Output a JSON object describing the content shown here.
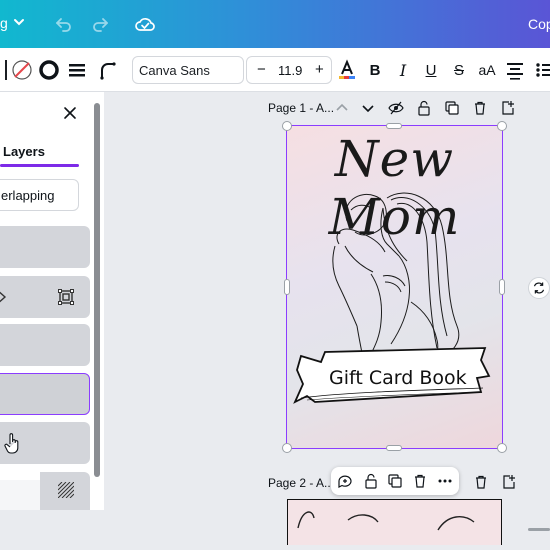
{
  "topbar": {
    "file_label": "g",
    "right_label": "Cop",
    "icons": [
      "chevron-down-icon",
      "undo-icon",
      "redo-icon",
      "cloud-saved-icon"
    ],
    "gradient": [
      "#11b8cf",
      "#5a55d6"
    ]
  },
  "toolbar": {
    "font_name": "Canva Sans",
    "font_size": "11.9",
    "minus": "−",
    "plus": "+",
    "bold": "B",
    "italic": "I",
    "underline": "U",
    "strike": "S",
    "case": "aA",
    "text_color_bar": "#e63b3b"
  },
  "panel": {
    "tab_label": "Layers",
    "search_placeholder": "erlapping",
    "accent": "#7d2ae8"
  },
  "canvas": {
    "page1_label": "Page 1 - A...",
    "page2_label": "Page 2 - A...",
    "design_title": "New Mom",
    "banner_text": "Gift Card Book",
    "selection_color": "#8b3dff"
  }
}
